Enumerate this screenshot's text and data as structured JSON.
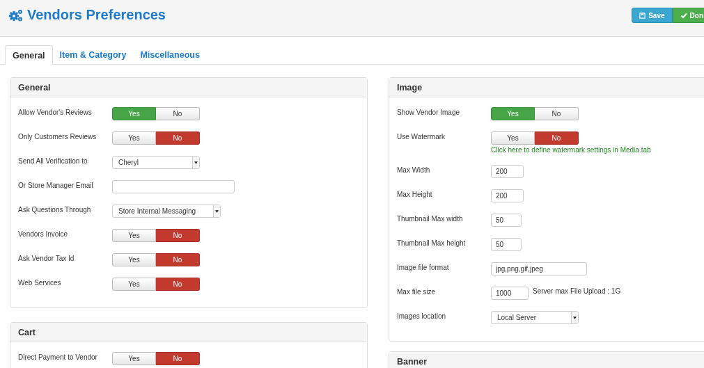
{
  "header": {
    "title": "Vendors Preferences",
    "buttons": [
      {
        "label": "Save",
        "kind": "save"
      },
      {
        "label": "Don",
        "kind": "done"
      }
    ]
  },
  "tabs": [
    {
      "label": "General",
      "selected": true
    },
    {
      "label": "Item & Category",
      "selected": false
    },
    {
      "label": "Miscellaneous",
      "selected": false
    }
  ],
  "columns": [
    [
      {
        "title": "General",
        "rows": [
          {
            "label": "Allow Vendor's Reviews",
            "kind": "toggle",
            "options": [
              {
                "label": "Yes",
                "kind": "yes",
                "selected": true
              },
              {
                "label": "No",
                "kind": "no",
                "selected": false
              }
            ]
          },
          {
            "label": "Only Customers Reviews",
            "kind": "toggle",
            "options": [
              {
                "label": "Yes",
                "kind": "yes",
                "selected": false
              },
              {
                "label": "No",
                "kind": "no",
                "selected": true
              }
            ]
          },
          {
            "label": "Send All Verification to",
            "kind": "select",
            "value": "Cheryl"
          },
          {
            "label": "Or Store Manager Email",
            "kind": "text"
          },
          {
            "label": "Ask Questions Through",
            "kind": "select",
            "value": "Store Internal Messaging"
          },
          {
            "label": "Vendors Invoice",
            "kind": "toggle",
            "options": [
              {
                "label": "Yes",
                "kind": "yes",
                "selected": false
              },
              {
                "label": "No",
                "kind": "no",
                "selected": true
              }
            ]
          },
          {
            "label": "Ask Vendor Tax Id",
            "kind": "toggle",
            "options": [
              {
                "label": "Yes",
                "kind": "yes",
                "selected": false
              },
              {
                "label": "No",
                "kind": "no",
                "selected": true
              }
            ]
          },
          {
            "label": "Web Services",
            "kind": "toggle",
            "options": [
              {
                "label": "Yes",
                "kind": "yes",
                "selected": false
              },
              {
                "label": "No",
                "kind": "no",
                "selected": true
              }
            ]
          }
        ]
      },
      {
        "title": "Cart",
        "rows": [
          {
            "label": "Direct Payment to Vendor",
            "kind": "toggle",
            "options": [
              {
                "label": "Yes",
                "kind": "yes",
                "selected": false
              },
              {
                "label": "No",
                "kind": "no",
                "selected": true
              }
            ]
          }
        ]
      }
    ],
    [
      {
        "title": "Image",
        "rows": [
          {
            "label": "Show Vendor Image",
            "kind": "toggle",
            "options": [
              {
                "label": "Yes",
                "kind": "yes",
                "selected": true
              },
              {
                "label": "No",
                "kind": "no",
                "selected": false
              }
            ]
          },
          {
            "label": "Use Watermark",
            "kind": "toggle",
            "options": [
              {
                "label": "Yes",
                "kind": "yes",
                "selected": false
              },
              {
                "label": "No",
                "kind": "no",
                "selected": true
              }
            ],
            "link": "Click here to define watermark settings in Media tab"
          },
          {
            "label": "Max Width",
            "kind": "text",
            "value": "200"
          },
          {
            "label": "Max Height",
            "kind": "text",
            "value": "200"
          },
          {
            "label": "Thumbnail Max width",
            "kind": "text",
            "value": "50"
          },
          {
            "label": "Thumbnail Max height",
            "kind": "text",
            "value": "50"
          },
          {
            "label": "Image file format",
            "kind": "text",
            "value": "jpg,png,gif,jpeg"
          },
          {
            "label": "Max file size",
            "kind": "text",
            "value": "1000",
            "note": "Server max File Upload : 1G"
          },
          {
            "label": "Images location",
            "kind": "select",
            "value": "Local Server"
          }
        ]
      },
      {
        "title": "Banner"
      }
    ]
  ]
}
